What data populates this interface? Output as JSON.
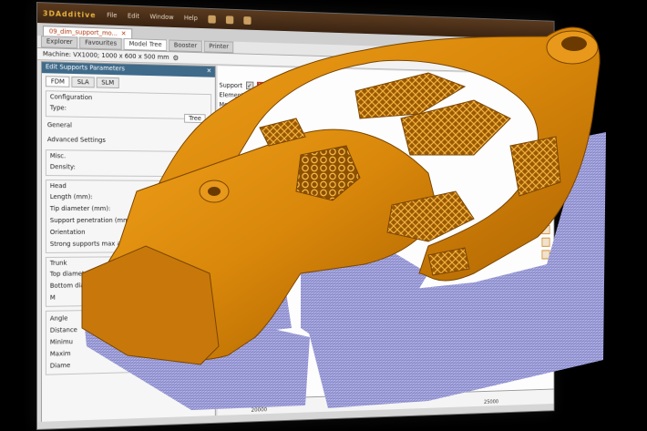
{
  "window": {
    "logo": "3DAdditive",
    "menu": [
      "File",
      "Edit",
      "Window",
      "Help"
    ],
    "document_tab": "09_dim_support_mo...",
    "mode_tabs": [
      "Explorer",
      "Favourites",
      "Model Tree",
      "Booster",
      "Printer"
    ],
    "machine": "Machine: VX1000; 1000 x 600 x 500 mm"
  },
  "panel": {
    "header": "Edit Supports Parameters",
    "tech_tabs": [
      "FDM",
      "SLA",
      "SLM"
    ],
    "configuration": {
      "label": "Configuration",
      "type_label": "Type:",
      "tree_button": "Tree"
    },
    "general_label": "General",
    "advanced_label": "Advanced Settings",
    "misc": {
      "label": "Misc.",
      "density": "Density:"
    },
    "head": {
      "label": "Head",
      "fields": [
        "Length (mm):",
        "Tip diameter (mm):",
        "Support penetration (mm):",
        "Orientation",
        "Strong supports max angle"
      ]
    },
    "trunk": {
      "label": "Trunk",
      "fields": [
        "Top diameter (mm):",
        "Bottom diameter (mm):",
        "M"
      ]
    },
    "lower": [
      "Angle",
      "Distance",
      "Minimu",
      "Maxim",
      "Diame"
    ]
  },
  "support_panel": {
    "label": "Support",
    "check_glyph": "✓",
    "cross_glyph": "✕",
    "elements": "Elements to support",
    "mode": "Mode: Area Sel"
  },
  "ruler": {
    "labels": [
      "25000",
      "20000"
    ]
  },
  "colors": {
    "part": "#d8870a",
    "support": "#a7a8de",
    "accent": "#b23a12"
  }
}
